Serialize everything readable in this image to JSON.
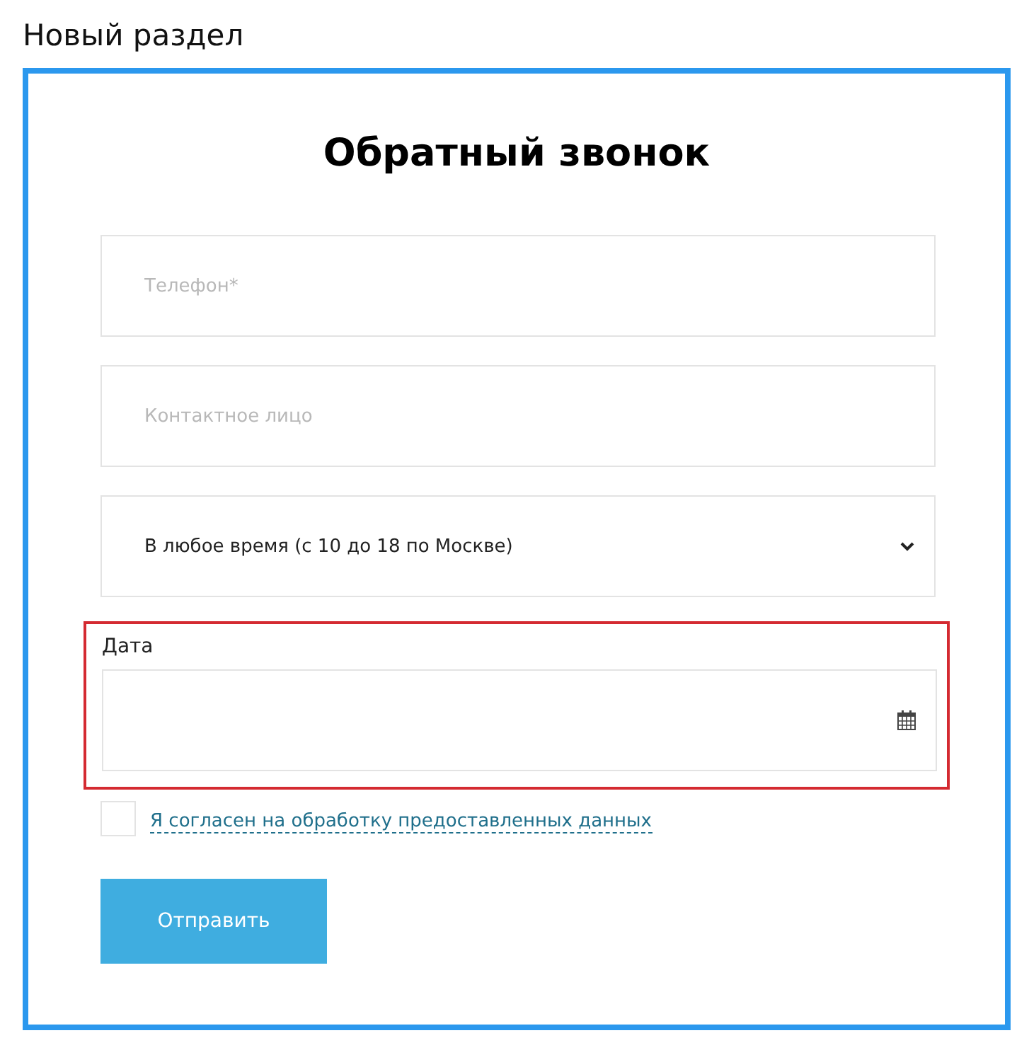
{
  "section_title": "Новый раздел",
  "form": {
    "title": "Обратный звонок",
    "fields": [
      {
        "kind": "text",
        "placeholder": "Телефон*"
      },
      {
        "kind": "text",
        "placeholder": "Контактное лицо"
      },
      {
        "kind": "select",
        "value": "В любое время (с 10 до 18 по Москве)"
      },
      {
        "kind": "date",
        "label": "Дата",
        "highlighted": true
      }
    ],
    "consent": {
      "checked": false,
      "label": "Я согласен на обработку предоставленных данных"
    },
    "submit": "Отправить"
  }
}
